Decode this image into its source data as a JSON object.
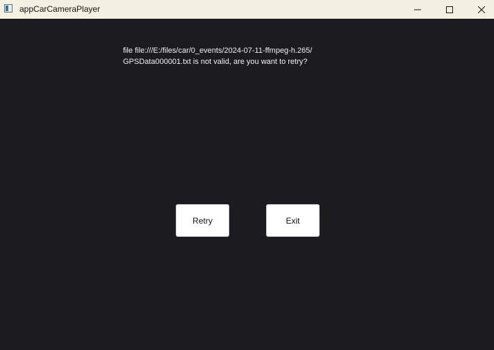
{
  "window": {
    "title": "appCarCameraPlayer",
    "controls": {
      "minimize_icon": "minimize-icon",
      "maximize_icon": "maximize-icon",
      "close_icon": "close-icon"
    },
    "colors": {
      "titlebar_bg": "#f5f1e2",
      "content_bg": "#1c1b20",
      "message_text": "#f2f2f2",
      "button_bg": "#ffffff"
    }
  },
  "message": {
    "line1": "file file:///E:/files/car/0_events/2024-07-11-ffmpeg-h.265/",
    "line2": "GPSData000001.txt is not valid, are you want to retry?"
  },
  "buttons": {
    "retry_label": "Retry",
    "exit_label": "Exit"
  }
}
